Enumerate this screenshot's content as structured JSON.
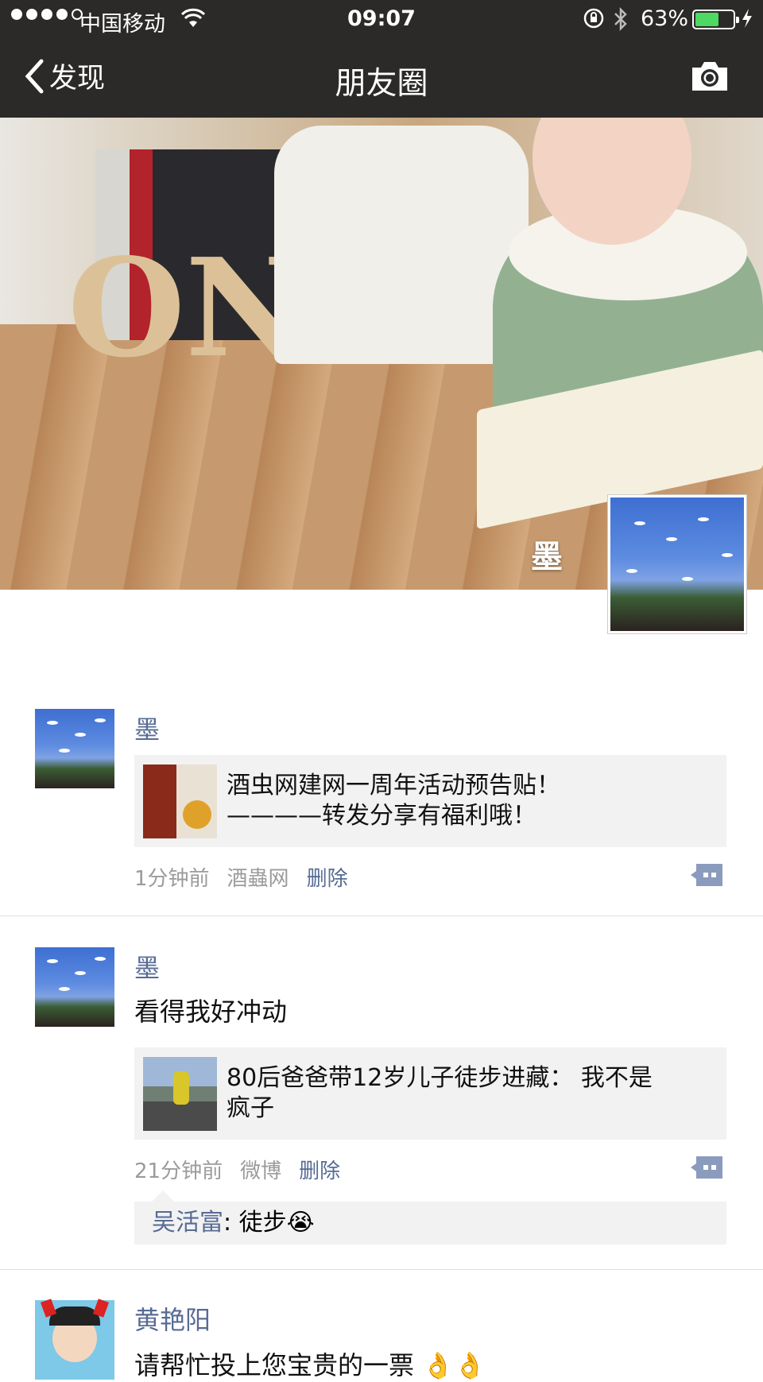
{
  "status_bar": {
    "carrier": "中国移动",
    "time": "09:07",
    "battery_percent": "63%",
    "battery_level": 0.63
  },
  "nav": {
    "back_label": "发现",
    "title": "朋友圈"
  },
  "cover": {
    "owner_name": "墨"
  },
  "posts": [
    {
      "author": "墨",
      "text": "",
      "link_line1": "酒虫网建网一周年活动预告贴！",
      "link_line2": "————转发分享有福利哦！",
      "time": "1分钟前",
      "source": "酒蟲网",
      "delete_label": "删除"
    },
    {
      "author": "墨",
      "text": "看得我好冲动",
      "link_line1": "80后爸爸带12岁儿子徒步进藏： 我不是",
      "link_line2": "疯子",
      "time": "21分钟前",
      "source": "微博",
      "delete_label": "删除",
      "comment_author": "吴活富",
      "comment_text": ": 徒步😭"
    },
    {
      "author": "黄艳阳",
      "text": "请帮忙投上您宝贵的一票 👌👌"
    }
  ],
  "colors": {
    "bar_bg": "#2b2a29",
    "name_blue": "#576b95",
    "battery_green": "#4cd964",
    "bubble_bg": "#f2f2f2"
  }
}
